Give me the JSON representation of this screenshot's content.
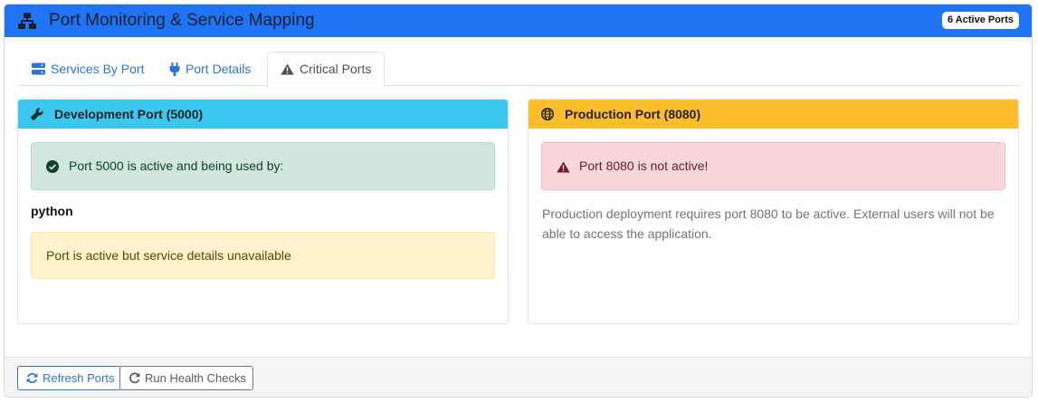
{
  "header": {
    "title": "Port Monitoring & Service Mapping",
    "badge": "6 Active Ports",
    "icon": "network-icon"
  },
  "tabs": [
    {
      "label": "Services By Port",
      "icon": "server-icon",
      "active": false
    },
    {
      "label": "Port Details",
      "icon": "plug-icon",
      "active": false
    },
    {
      "label": "Critical Ports",
      "icon": "warning-icon",
      "active": true
    }
  ],
  "dev": {
    "title": "Development Port (5000)",
    "header_color": "#3cc8ee",
    "status": "Port 5000 is active and being used by:",
    "process": "python",
    "note": "Port is active but service details unavailable"
  },
  "prod": {
    "title": "Production Port (8080)",
    "header_color": "#fbbd2a",
    "status": "Port 8080 is not active!",
    "description": "Production deployment requires port 8080 to be active. External users will not be able to access the application."
  },
  "footer": {
    "refresh_label": "Refresh Ports",
    "health_label": "Run Health Checks"
  }
}
